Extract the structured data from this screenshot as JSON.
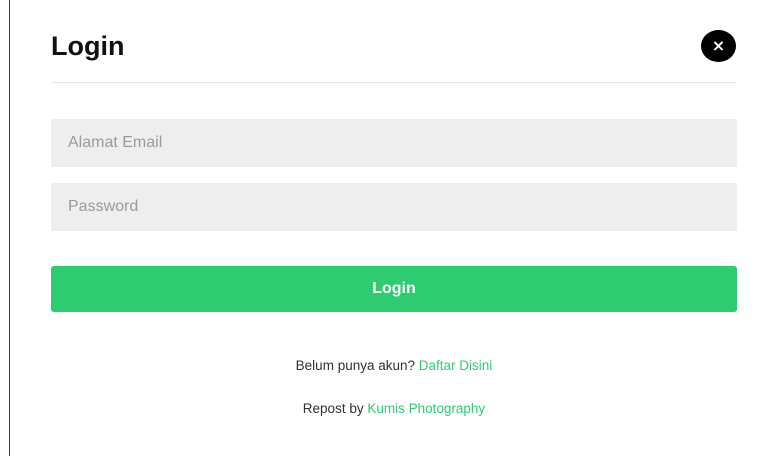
{
  "modal": {
    "title": "Login",
    "close_symbol": "×"
  },
  "form": {
    "email_placeholder": "Alamat Email",
    "password_placeholder": "Password",
    "submit_label": "Login"
  },
  "footer": {
    "register_prompt": "Belum punya akun?",
    "register_link": "Daftar Disini",
    "repost_prefix": "Repost by",
    "repost_link": "Kumis Photography"
  },
  "colors": {
    "accent": "#2ecc71",
    "field_bg": "#eeeeee",
    "close_bg": "#000000"
  },
  "icons": {
    "close": "close-icon"
  }
}
